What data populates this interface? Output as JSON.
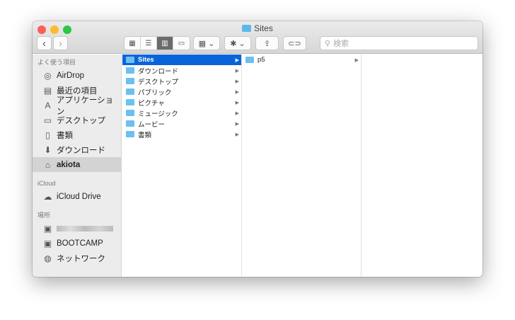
{
  "window": {
    "title": "Sites"
  },
  "toolbar": {
    "back": "‹",
    "forward": "›",
    "views": [
      "icon",
      "list",
      "column",
      "gallery"
    ],
    "group": "group",
    "action": "action",
    "share": "share",
    "tag": "tag",
    "search_placeholder": "検索"
  },
  "sidebar": {
    "favorites_header": "よく使う項目",
    "favorites": [
      {
        "label": "AirDrop",
        "icon": "◎"
      },
      {
        "label": "最近の項目",
        "icon": "▤"
      },
      {
        "label": "アプリケーション",
        "icon": "A"
      },
      {
        "label": "デスクトップ",
        "icon": "▭"
      },
      {
        "label": "書類",
        "icon": "▯"
      },
      {
        "label": "ダウンロード",
        "icon": "⬇"
      },
      {
        "label": "akiota",
        "icon": "⌂"
      }
    ],
    "icloud_header": "iCloud",
    "icloud": [
      {
        "label": "iCloud Drive",
        "icon": "☁"
      }
    ],
    "locations_header": "場所",
    "locations": [
      {
        "label": "BOOTCAMP",
        "icon": "▣"
      },
      {
        "label": "ネットワーク",
        "icon": "◍"
      }
    ]
  },
  "columns": [
    {
      "items": [
        "Sites",
        "ダウンロード",
        "デスクトップ",
        "パブリック",
        "ピクチャ",
        "ミュージック",
        "ムービー",
        "書類"
      ],
      "selected": 0
    },
    {
      "items": [
        "p5"
      ]
    }
  ],
  "colors": {
    "selection": "#0a64d9",
    "folder": "#6cc0ef"
  }
}
